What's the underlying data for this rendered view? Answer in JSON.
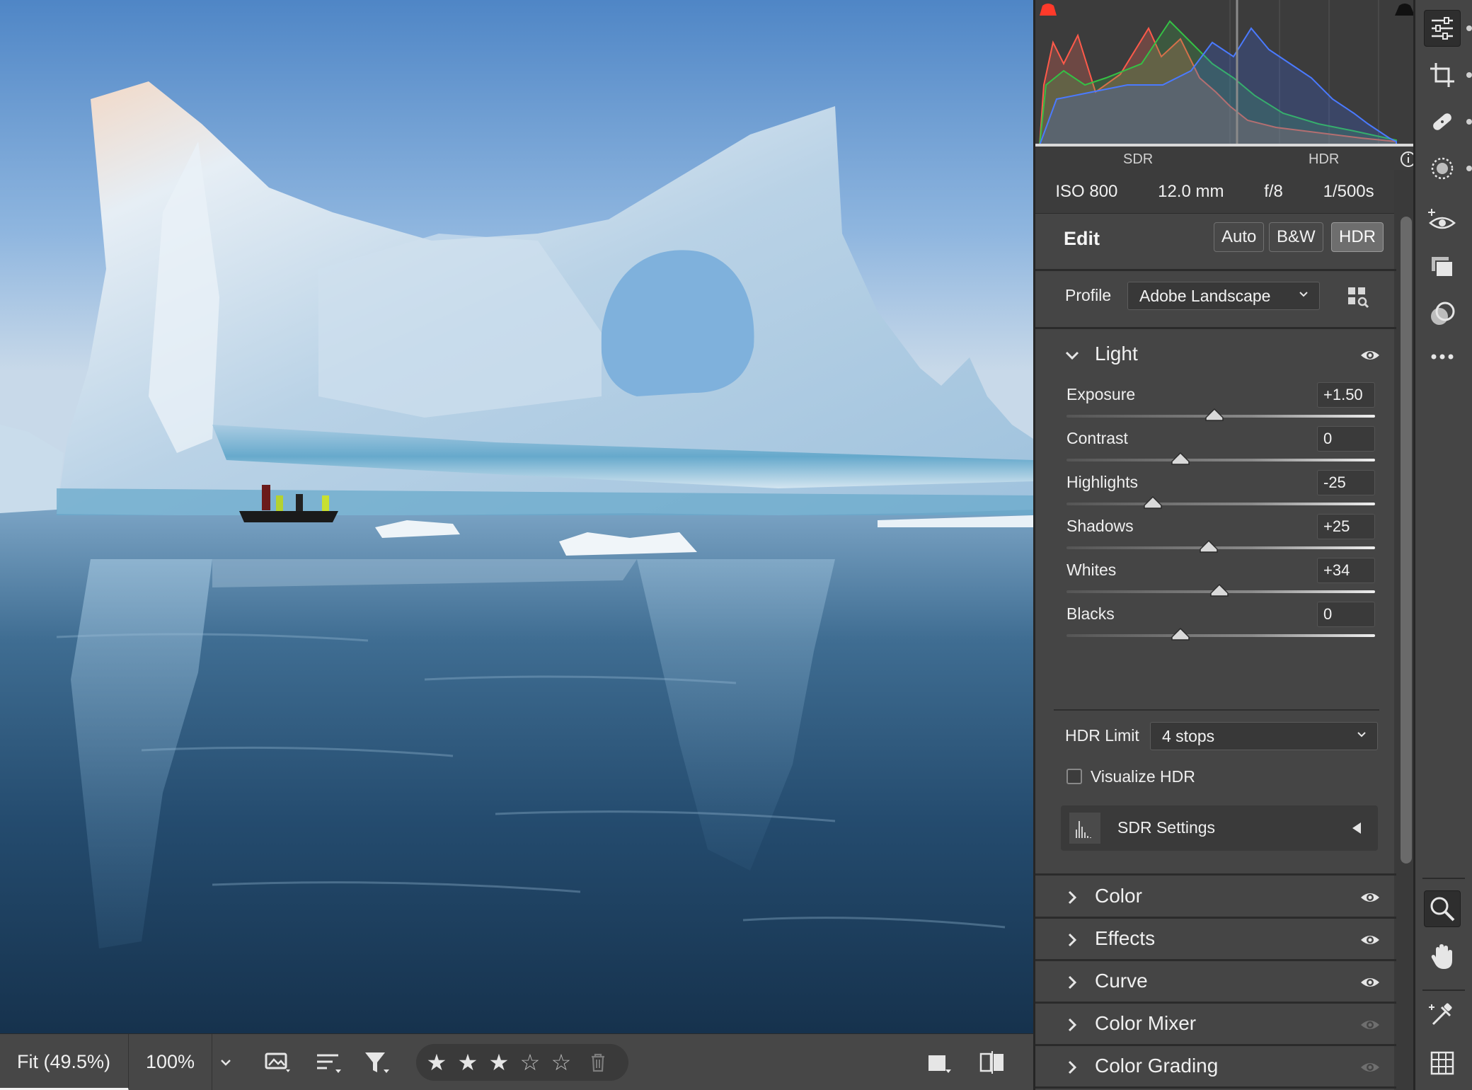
{
  "histogram": {
    "left_label": "SDR",
    "right_label": "HDR"
  },
  "exif": {
    "iso": "ISO 800",
    "focal": "12.0 mm",
    "aperture": "f/8",
    "shutter": "1/500s"
  },
  "edit": {
    "title": "Edit",
    "buttons": [
      "Auto",
      "B&W",
      "HDR"
    ],
    "active_button": "HDR",
    "profile_label": "Profile",
    "profile_value": "Adobe Landscape"
  },
  "light": {
    "title": "Light",
    "sliders": [
      {
        "name": "Exposure",
        "value": "+1.50",
        "position": 0.48
      },
      {
        "name": "Contrast",
        "value": "0",
        "position": 0.37
      },
      {
        "name": "Highlights",
        "value": "-25",
        "position": 0.28
      },
      {
        "name": "Shadows",
        "value": "+25",
        "position": 0.46
      },
      {
        "name": "Whites",
        "value": "+34",
        "position": 0.495
      },
      {
        "name": "Blacks",
        "value": "0",
        "position": 0.37
      }
    ],
    "hdr_limit_label": "HDR Limit",
    "hdr_limit_value": "4 stops",
    "visualize_label": "Visualize HDR",
    "visualize_checked": false,
    "sdr_settings_label": "SDR Settings"
  },
  "sections": [
    {
      "title": "Color",
      "visible": true
    },
    {
      "title": "Effects",
      "visible": true
    },
    {
      "title": "Curve",
      "visible": true
    },
    {
      "title": "Color Mixer",
      "visible": false
    },
    {
      "title": "Color Grading",
      "visible": false
    }
  ],
  "bottom": {
    "zoom_fit": "Fit (49.5%)",
    "zoom_100": "100%",
    "rating": 3,
    "max_rating": 5
  },
  "colors": {
    "panel_bg": "#454545",
    "accent": "#f2f2f2"
  },
  "rail_icons": [
    "edit-sliders-icon",
    "crop-icon",
    "healing-icon",
    "masking-icon",
    "red-eye-icon",
    "snapshots-icon",
    "presets-icon",
    "more-icon",
    "zoom-icon",
    "hand-icon",
    "sampler-icon",
    "grid-icon"
  ]
}
